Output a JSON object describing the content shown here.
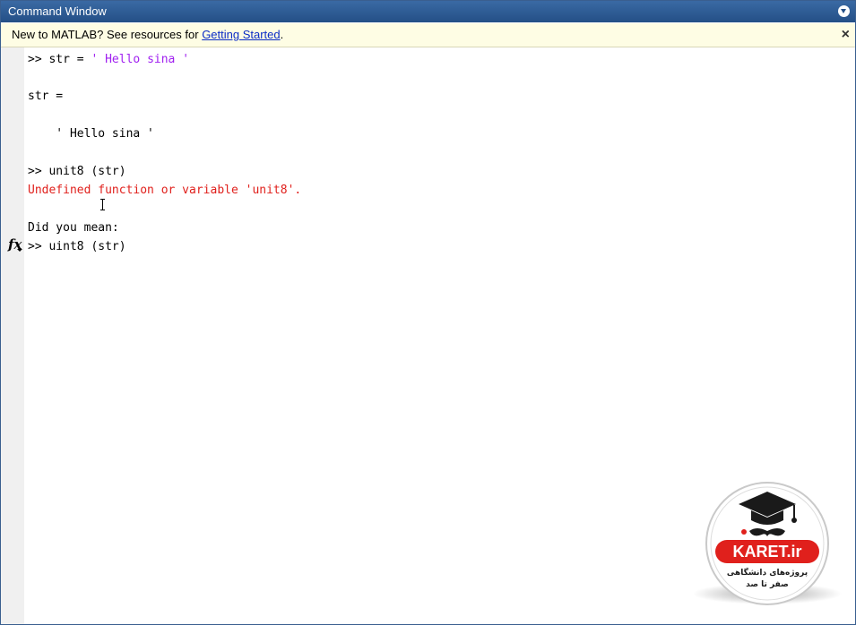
{
  "window": {
    "title": "Command Window"
  },
  "infobar": {
    "message": "New to MATLAB? See resources for ",
    "link": "Getting Started",
    "suffix": ".",
    "close_glyph": "×"
  },
  "console": {
    "lines": [
      {
        "prompt": ">> ",
        "code": "str = ",
        "string": "' Hello sina '"
      },
      {
        "text": "str ="
      },
      {
        "text": "    ' Hello sina '"
      },
      {
        "prompt": ">> ",
        "code": "unit8 (str)"
      },
      {
        "error": "Undefined function or variable 'unit8'."
      },
      {
        "text": "Did you mean:"
      },
      {
        "prompt": ">> ",
        "code": "uint8 (str)"
      }
    ],
    "fx_label": "fx"
  },
  "logo": {
    "brand": "KARET.ir",
    "tagline_line1": "پروژه‌های دانشگاهی",
    "tagline_line2": "صفر تا صد"
  },
  "colors": {
    "titlebar": "#2f5c96",
    "infobar_bg": "#fefde4",
    "string": "#a020f0",
    "error": "#e0201c",
    "link": "#0b2cc6",
    "logo_red": "#e0201c"
  }
}
